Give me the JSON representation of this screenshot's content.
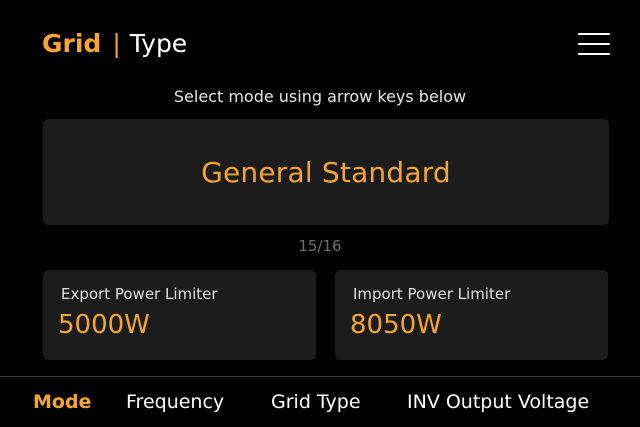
{
  "header": {
    "section": "Grid",
    "separator": "|",
    "subsection": "Type"
  },
  "menu": {
    "icon": "hamburger-menu-icon"
  },
  "instruction": "Select mode using arrow keys below",
  "mode": {
    "value": "General Standard"
  },
  "pagination": {
    "text": "15/16"
  },
  "limiters": {
    "export": {
      "label": "Export Power Limiter",
      "value": "5000W"
    },
    "import": {
      "label": "Import Power Limiter",
      "value": "8050W"
    }
  },
  "tabs": [
    {
      "label": "Mode",
      "active": true
    },
    {
      "label": "Frequency",
      "active": false
    },
    {
      "label": "Grid Type",
      "active": false
    },
    {
      "label": "INV Output Voltage",
      "active": false
    }
  ],
  "colors": {
    "accent": "#f6a531",
    "background": "#000000",
    "card": "#1c1c1c",
    "text": "#ffffff",
    "muted": "#6e6e6e"
  }
}
